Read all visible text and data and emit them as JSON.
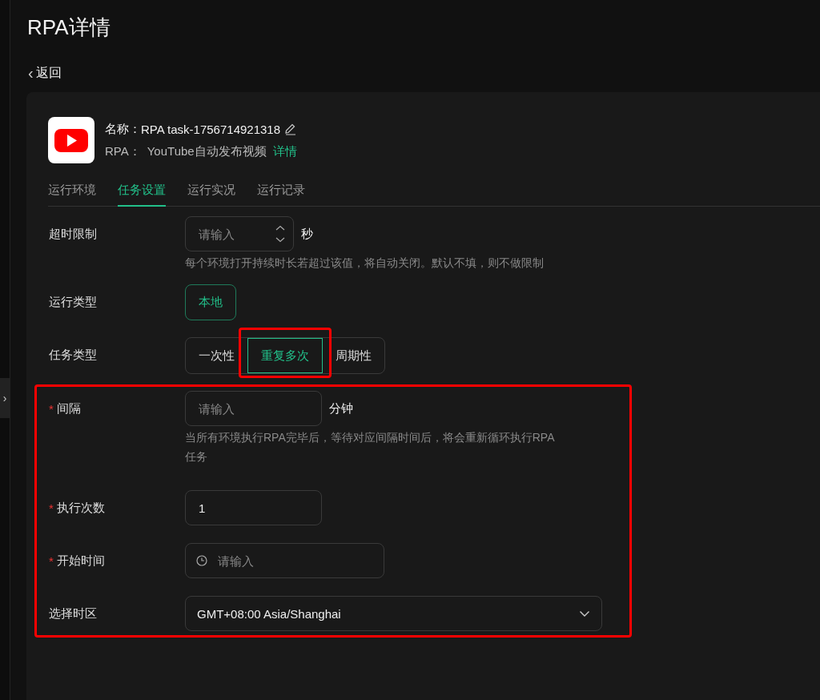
{
  "page_title": "RPA详情",
  "back": {
    "icon": "‹",
    "label": "返回"
  },
  "sidebar_toggle": {
    "icon": "›"
  },
  "task": {
    "name_label": "名称：",
    "name": "RPA task-1756714921318",
    "rpa_label": "RPA：",
    "rpa_name": "YouTube自动发布视频",
    "detail_link": "详情"
  },
  "tabs": [
    {
      "label": "运行环境",
      "selected": false
    },
    {
      "label": "任务设置",
      "selected": true
    },
    {
      "label": "运行实况",
      "selected": false
    },
    {
      "label": "运行记录",
      "selected": false
    }
  ],
  "form": [
    {
      "kind": "stepper",
      "label": "超时限制",
      "placeholder": "请输入",
      "unit": "秒",
      "hint": "每个环境打开持续时长若超过该值，将自动关闭。默认不填，则不做限制"
    },
    {
      "kind": "choice",
      "label": "运行类型",
      "options": [
        {
          "label": "本地",
          "selected": true,
          "highlighted": false
        }
      ]
    },
    {
      "kind": "segmented",
      "label": "任务类型",
      "options": [
        {
          "label": "一次性",
          "selected": false,
          "highlighted": false
        },
        {
          "label": "重复多次",
          "selected": true,
          "highlighted": true
        },
        {
          "label": "周期性",
          "selected": false,
          "highlighted": false
        }
      ]
    }
  ],
  "repeat_settings": {
    "highlighted": true,
    "rows": [
      {
        "kind": "input",
        "required_mark": "*",
        "label": "间隔",
        "placeholder": "请输入",
        "unit": "分钟",
        "hint": "当所有环境执行RPA完毕后，等待对应间隔时间后，将会重新循环执行RPA任务"
      },
      {
        "kind": "input",
        "required_mark": "*",
        "label": "执行次数",
        "value": "1"
      },
      {
        "kind": "time",
        "required_mark": "*",
        "label": "开始时间",
        "placeholder": "请输入"
      },
      {
        "kind": "select",
        "label": "选择时区",
        "value": "GMT+08:00 Asia/Shanghai"
      }
    ]
  }
}
